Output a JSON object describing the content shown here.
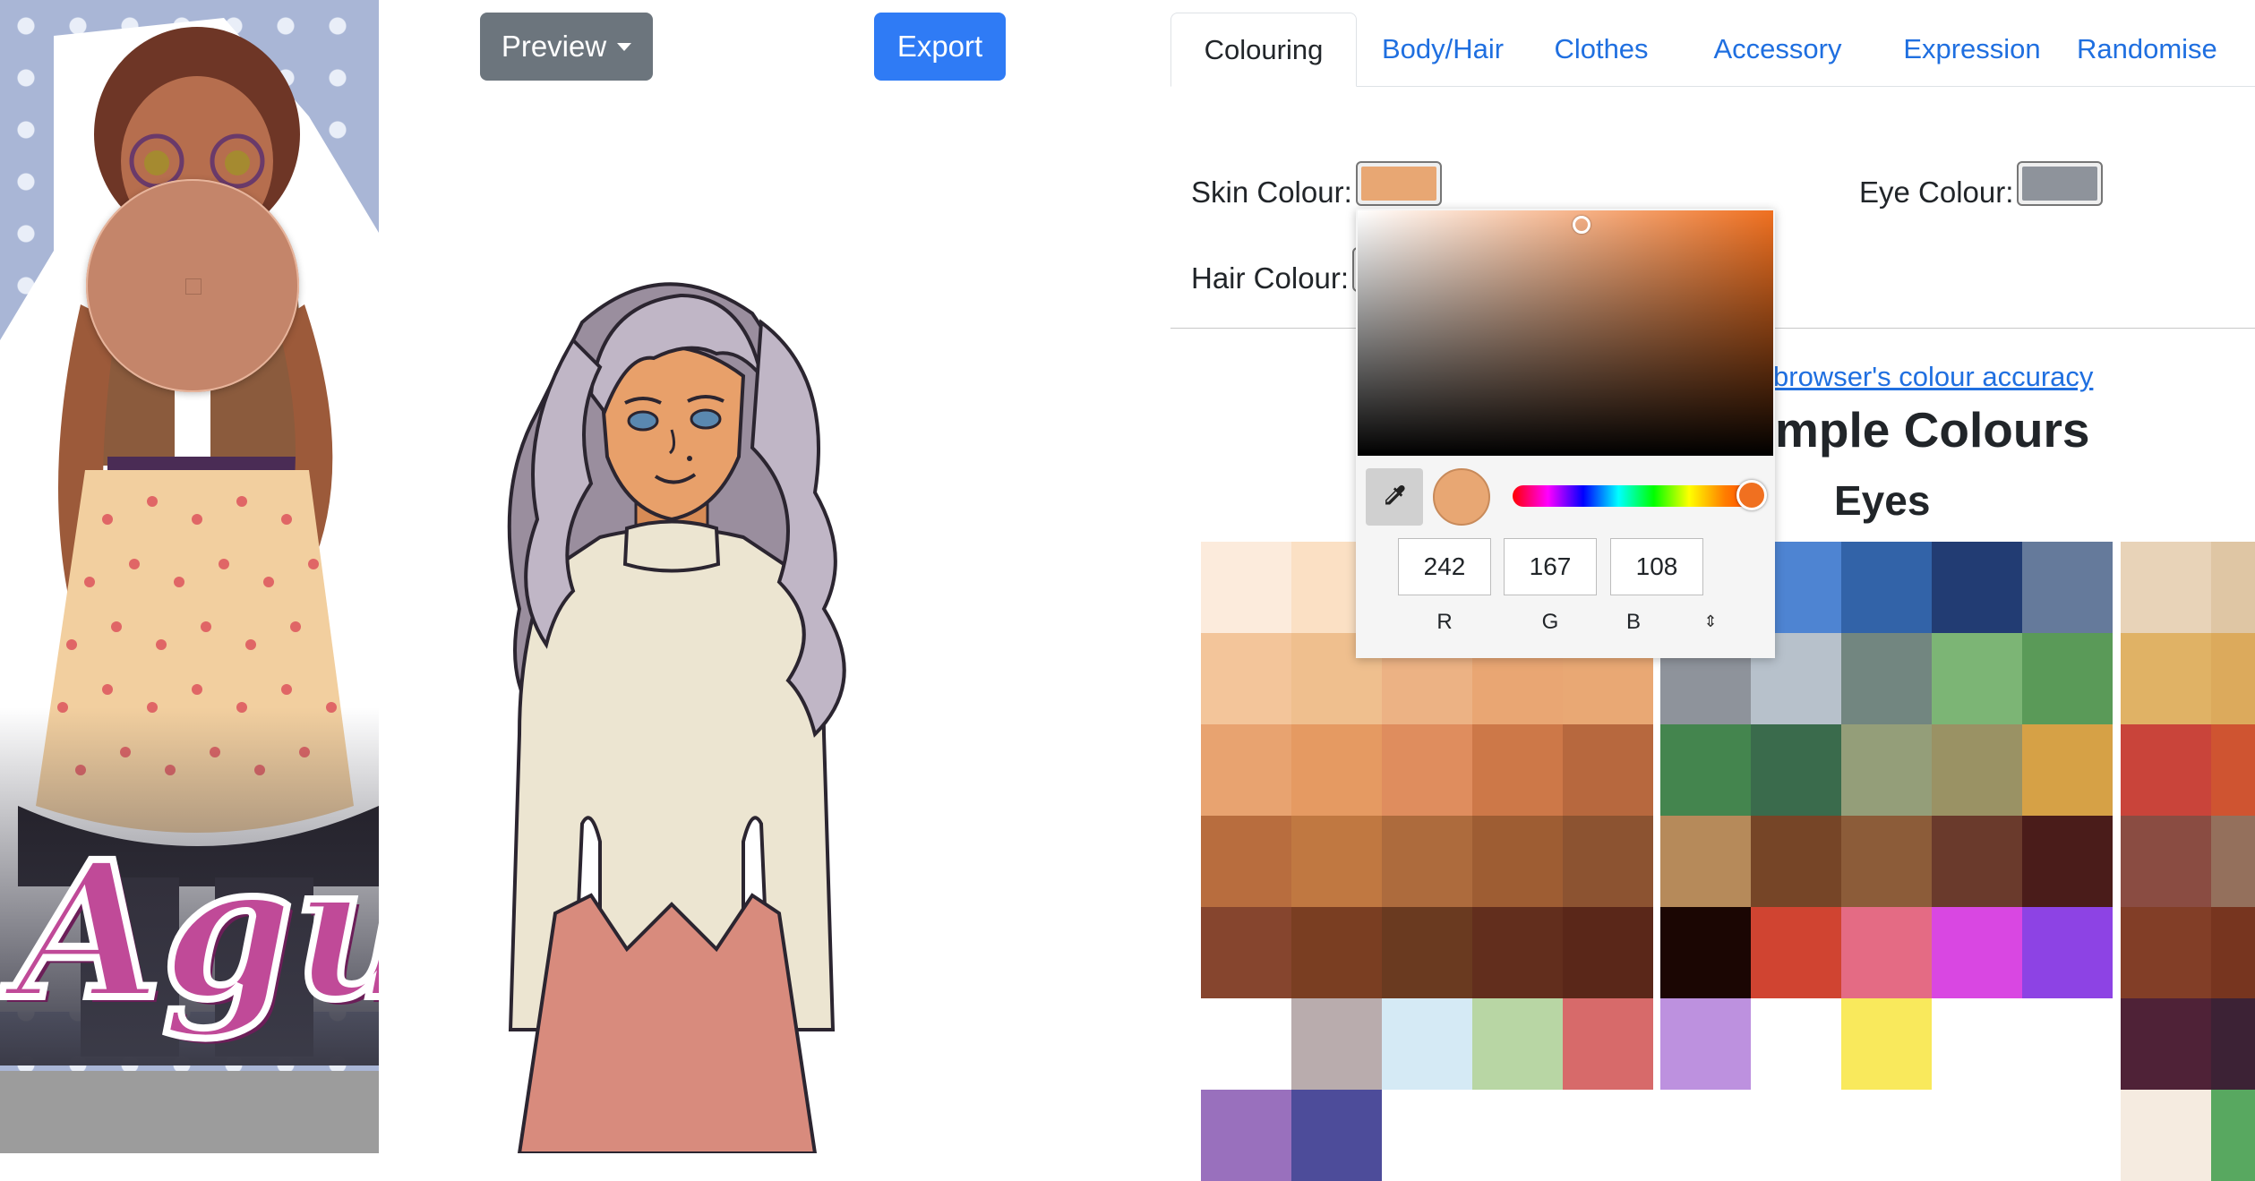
{
  "toolbar": {
    "preview_label": "Preview",
    "export_label": "Export"
  },
  "reference": {
    "logo_text": "Agus"
  },
  "tabs": [
    {
      "label": "Colouring",
      "active": true
    },
    {
      "label": "Body/Hair",
      "active": false
    },
    {
      "label": "Clothes",
      "active": false
    },
    {
      "label": "Accessory",
      "active": false
    },
    {
      "label": "Expression",
      "active": false
    },
    {
      "label": "Randomise",
      "active": false
    }
  ],
  "colouring": {
    "skin_label": "Skin Colour:",
    "skin_value": "#e8a773",
    "eye_label": "Eye Colour:",
    "eye_value": "#8e939b",
    "hair_label": "Hair Colour:"
  },
  "samples": {
    "accuracy_link": "browser's colour accuracy",
    "title": "mple Colours",
    "eyes_heading": "Eyes"
  },
  "picker": {
    "r": "242",
    "g": "167",
    "b": "108",
    "r_label": "R",
    "g_label": "G",
    "b_label": "B",
    "current_color": "#e8a773"
  },
  "palettes": {
    "skin": [
      [
        "#fcebdc",
        "#fbe0c4",
        "",
        "",
        ""
      ],
      [
        "#f3c59a",
        "#efbf8e",
        "#ecb284",
        "#e9a673",
        "#e9a874"
      ],
      [
        "#e8a370",
        "#e59a62",
        "#df8d5e",
        "#cd7848",
        "#b7683e"
      ],
      [
        "#b86d3e",
        "#c07841",
        "#ad6b3d",
        "#9e5d33",
        "#8c5331"
      ],
      [
        "#86452e",
        "#7a3e22",
        "#6a3a20",
        "#622e1d",
        "#5a2719"
      ],
      [
        "#ffffff",
        "#b9acad",
        "#d5eaf5",
        "#b8d6a4",
        "#d76a6a"
      ],
      [
        "#9970bd",
        "#4d4c9a",
        "",
        "",
        ""
      ]
    ],
    "eyes": [
      [
        "",
        "#4e84d2",
        "#3263a8",
        "#223c73",
        "#657a9b"
      ],
      [
        "#8e939b",
        "#b7c1cb",
        "#728680",
        "#7cb575",
        "#5a9a58"
      ],
      [
        "#44854e",
        "#3a6b4c",
        "#949e79",
        "#9a9264",
        "#d6a146"
      ],
      [
        "#b68a5a",
        "#764527",
        "#8c5c39",
        "#6a3a2c",
        "#4a1c1a"
      ],
      [
        "#1b0603",
        "#d04431",
        "#e46b84",
        "#d947e2",
        "#8d43e4"
      ],
      [
        "#bd91df",
        "",
        "#f9e95c",
        "",
        ""
      ]
    ],
    "hair": [
      [
        "#e8d3b8",
        "#dfc6a4"
      ],
      [
        "#e0b265",
        "#dcaa5c"
      ],
      [
        "#c9443a",
        "#cf5431"
      ],
      [
        "#8a4c42",
        "#94705c"
      ],
      [
        "#823e27",
        "#77351f"
      ],
      [
        "#4f2237",
        "#3c2235"
      ],
      [
        "#f5ebe0",
        "#58a860"
      ]
    ]
  }
}
